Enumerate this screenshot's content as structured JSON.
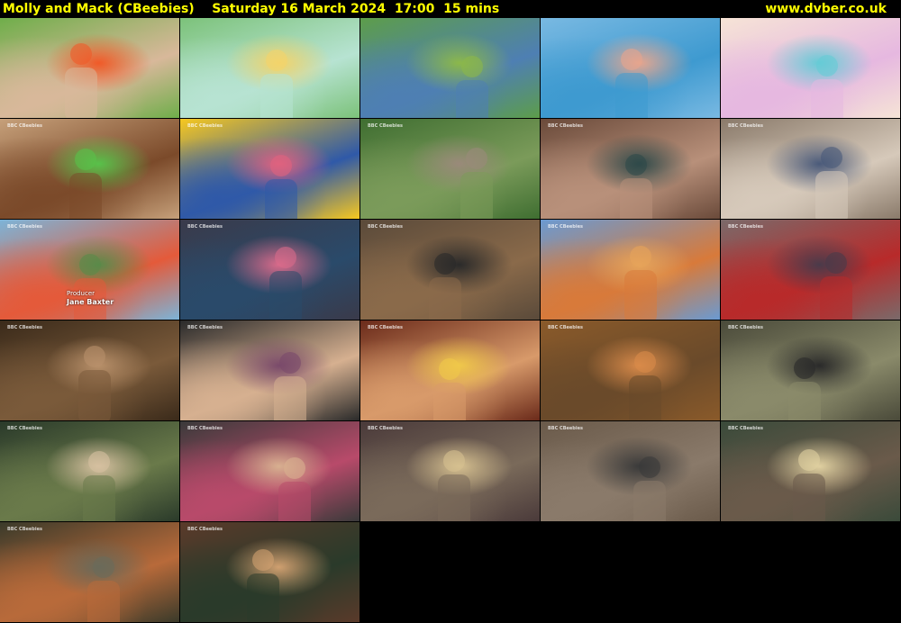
{
  "header": {
    "title": "Molly and Mack (CBeebies)    Saturday 16 March 2024  17:00  15 mins",
    "site": "www.dvber.co.uk"
  },
  "credits": {
    "role": "Producer",
    "name": "Jane Baxter"
  },
  "badge_text": "BBC CBeebies",
  "thumbnails": [
    {
      "scene": "cartoon-girl-reading-book-icon",
      "colors": [
        "#6fae4a",
        "#d8b89a",
        "#f05a28"
      ]
    },
    {
      "scene": "cartoon-rabbit-in-forest-icon",
      "colors": [
        "#7cc27a",
        "#b7e3d2",
        "#f3d36a"
      ]
    },
    {
      "scene": "cartoon-village-house-icon",
      "colors": [
        "#5d9d4a",
        "#4e7fb3",
        "#8cb84a"
      ]
    },
    {
      "scene": "cartoon-rabbit-sleeping-icon",
      "colors": [
        "#79b9e2",
        "#3e9ad0",
        "#e6a58d"
      ]
    },
    {
      "scene": "cartoon-end-card-icon",
      "colors": [
        "#f6e4d6",
        "#e6b8e0",
        "#66cbd6"
      ]
    },
    {
      "scene": "plush-toys-and-football-icon",
      "colors": [
        "#c6a07a",
        "#7b4a2a",
        "#58c24a"
      ]
    },
    {
      "scene": "studio-presenter-with-puppets-icon",
      "colors": [
        "#f7c81f",
        "#2f59a8",
        "#e0627f"
      ]
    },
    {
      "scene": "family-in-garden-icon",
      "colors": [
        "#3f6e31",
        "#7b9b5a",
        "#9a8a7a"
      ]
    },
    {
      "scene": "woman-smiling-in-shop-icon",
      "colors": [
        "#6a4a3a",
        "#b8907a",
        "#2f4a4a"
      ]
    },
    {
      "scene": "children-in-cafe-icon",
      "colors": [
        "#8a7a6a",
        "#d6c9ba",
        "#4a5a7a"
      ]
    },
    {
      "scene": "colourful-mural-room-icon",
      "colors": [
        "#7cb4d8",
        "#e45a3a",
        "#5a8a4a"
      ]
    },
    {
      "scene": "man-and-girl-talking-icon",
      "colors": [
        "#3a3a4a",
        "#2a4a6a",
        "#d86a8a"
      ]
    },
    {
      "scene": "market-stall-group-icon",
      "colors": [
        "#5a4a3a",
        "#8a6a4a",
        "#2a2a2a"
      ]
    },
    {
      "scene": "girl-with-flower-crown-icon",
      "colors": [
        "#6a9ad2",
        "#d87a3a",
        "#e6a45a"
      ]
    },
    {
      "scene": "boy-in-red-shirt-icon",
      "colors": [
        "#7a6a6a",
        "#b82a2a",
        "#4a3a4a"
      ]
    },
    {
      "scene": "man-in-apron-icon",
      "colors": [
        "#3a2a1a",
        "#7a5a3a",
        "#b8906a"
      ]
    },
    {
      "scene": "cafe-counter-woman-icon",
      "colors": [
        "#2a2a2a",
        "#d6b090",
        "#7a4a6a"
      ]
    },
    {
      "scene": "girl-flower-crown-closeup-icon",
      "colors": [
        "#6a2a1a",
        "#d89a6a",
        "#f0c84a"
      ]
    },
    {
      "scene": "wooden-stairs-children-icon",
      "colors": [
        "#8a5a2a",
        "#6a4a2a",
        "#d88a4a"
      ]
    },
    {
      "scene": "shop-aisle-people-icon",
      "colors": [
        "#4a4a3a",
        "#8a8a6a",
        "#2a2a2a"
      ]
    },
    {
      "scene": "boy-in-apron-icon",
      "colors": [
        "#2a3a2a",
        "#6a7a4a",
        "#d6c0a0"
      ]
    },
    {
      "scene": "little-girl-pigtails-icon",
      "colors": [
        "#3a3a3a",
        "#b84a6a",
        "#d8b090"
      ]
    },
    {
      "scene": "couple-in-gallery-icon",
      "colors": [
        "#4a3a3a",
        "#7a6a5a",
        "#d6c090"
      ]
    },
    {
      "scene": "antiques-shop-icon",
      "colors": [
        "#6a5a4a",
        "#8a7a6a",
        "#3a3a3a"
      ]
    },
    {
      "scene": "couple-at-table-icon",
      "colors": [
        "#3a4a3a",
        "#6a5a4a",
        "#e0d0a0"
      ]
    },
    {
      "scene": "woman-and-boy-shop-icon",
      "colors": [
        "#3a3a2a",
        "#b86a3a",
        "#6a6a5a"
      ]
    },
    {
      "scene": "cafe-counter-man-icon",
      "colors": [
        "#5a3a2a",
        "#2a3a2a",
        "#d0a070"
      ]
    }
  ]
}
